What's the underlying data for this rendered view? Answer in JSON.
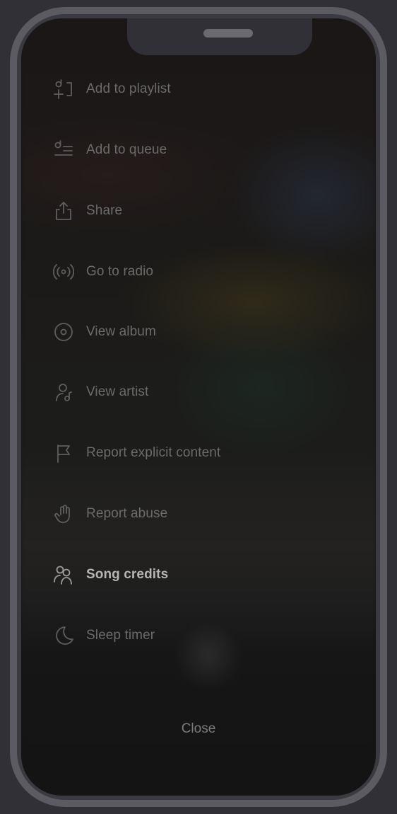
{
  "menu": {
    "items": [
      {
        "label": "Add to playlist",
        "icon": "add-to-playlist-icon"
      },
      {
        "label": "Add to queue",
        "icon": "add-to-queue-icon"
      },
      {
        "label": "Share",
        "icon": "share-icon"
      },
      {
        "label": "Go to radio",
        "icon": "radio-icon"
      },
      {
        "label": "View album",
        "icon": "album-icon"
      },
      {
        "label": "View artist",
        "icon": "artist-icon"
      },
      {
        "label": "Report explicit content",
        "icon": "flag-icon"
      },
      {
        "label": "Report abuse",
        "icon": "hand-icon"
      },
      {
        "label": "Song credits",
        "icon": "song-credits-icon"
      },
      {
        "label": "Sleep timer",
        "icon": "moon-icon"
      }
    ],
    "active_item": "Song credits"
  },
  "close_label": "Close",
  "colors": {
    "background": "#303036",
    "frame": "#5b5b61",
    "screen": "#151515",
    "text": "#6b6b6b",
    "active_text": "#b6b6b6"
  }
}
